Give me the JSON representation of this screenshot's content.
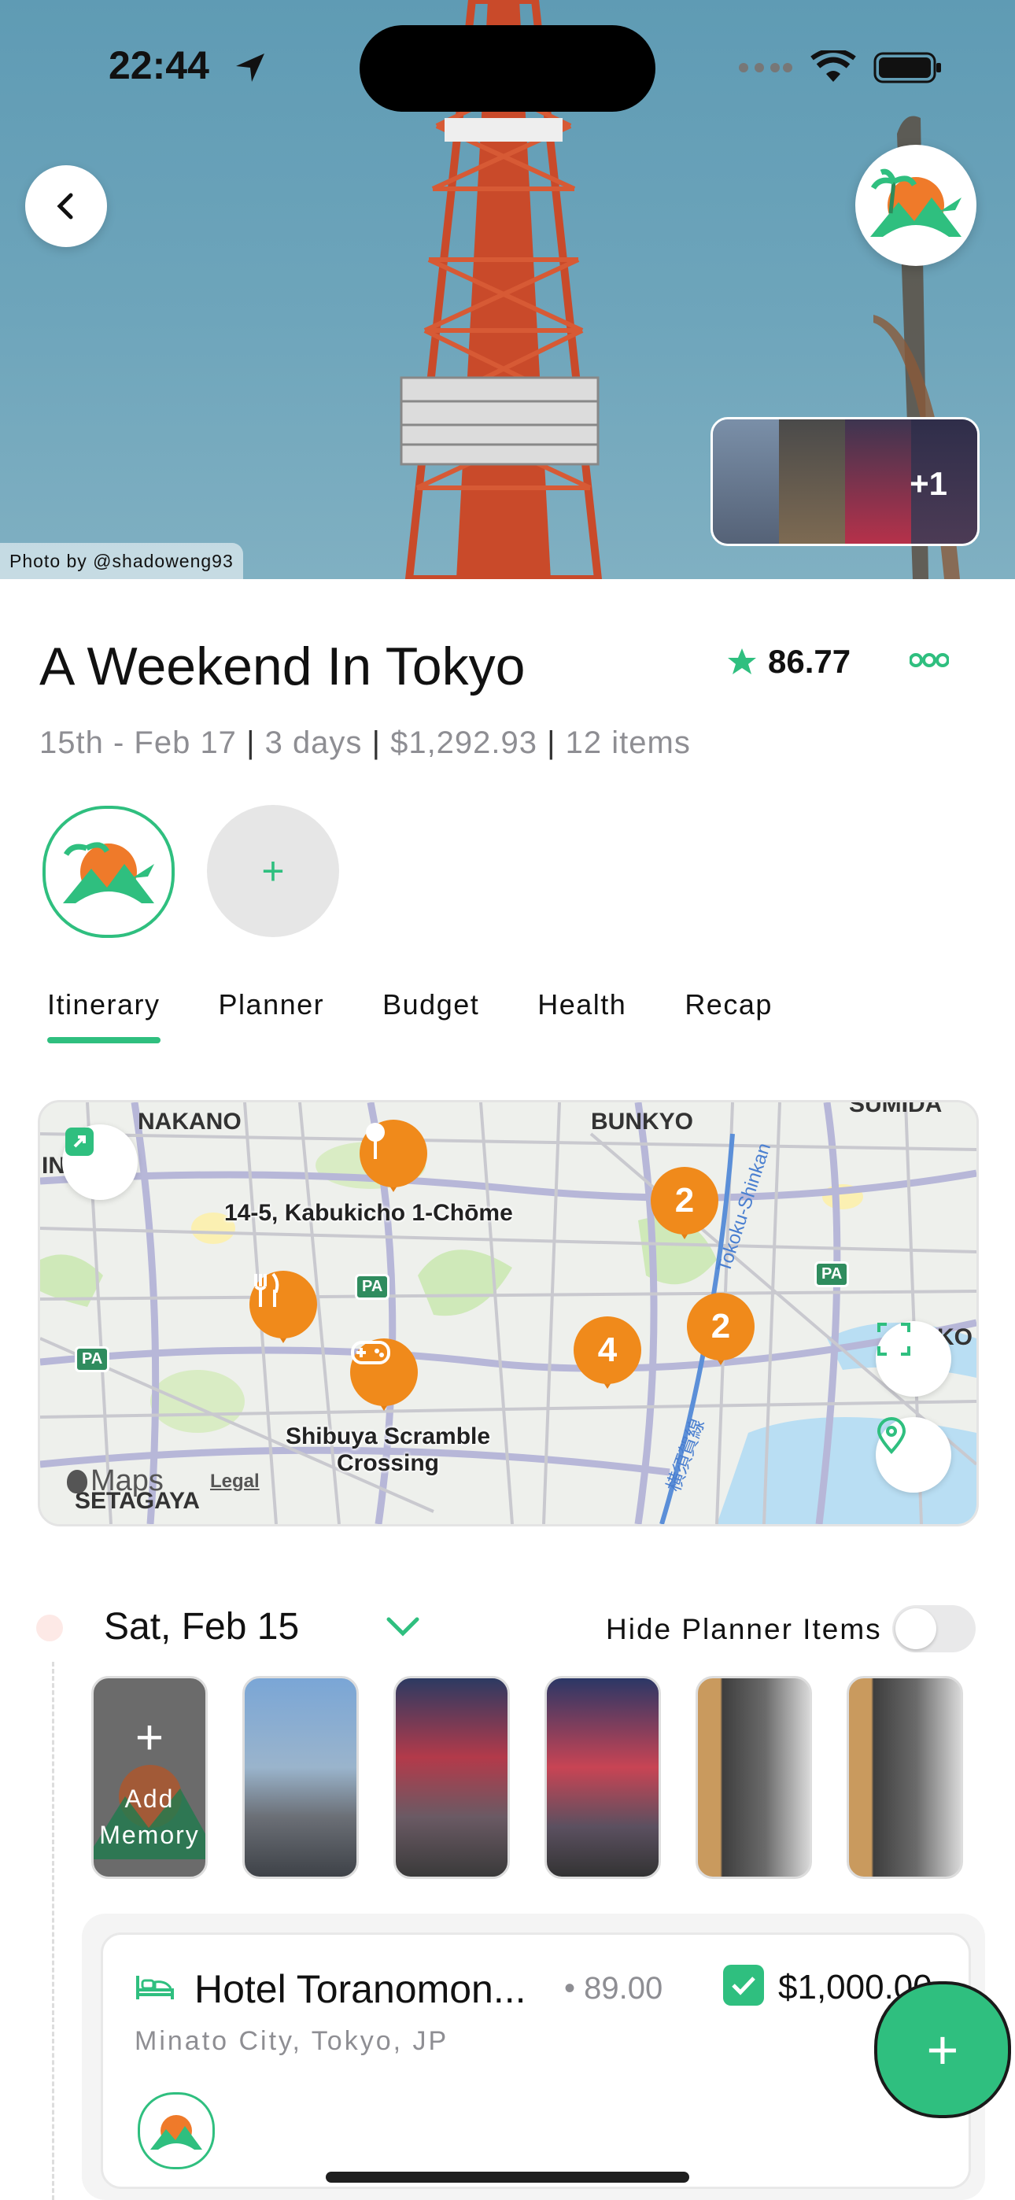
{
  "status": {
    "time": "22:44"
  },
  "hero": {
    "photo_credit": "Photo by @shadoweng93",
    "more_photos": "+1"
  },
  "trip": {
    "title": "A Weekend In Tokyo",
    "score": "86.77",
    "dates": "15th - Feb 17",
    "duration": "3 days",
    "cost": "$1,292.93",
    "items": "12 items",
    "sep": "|"
  },
  "add_member": "+",
  "tabs": [
    "Itinerary",
    "Planner",
    "Budget",
    "Health",
    "Recap"
  ],
  "map": {
    "areas": [
      "NAKANO",
      "BUNKYO",
      "SUMIDA",
      "SETAGAYA",
      "KO",
      "IN"
    ],
    "pins": [
      {
        "label": "14-5, Kabukicho 1-Chōme",
        "glyph": "pin-icon"
      },
      {
        "label": "2"
      },
      {
        "label": "2"
      },
      {
        "label": "4"
      },
      {
        "label": "fork-knife-icon"
      },
      {
        "label": "gamepad-icon"
      }
    ],
    "place_labels": [
      "14-5, Kabukicho 1-Chōme",
      "Shibuya Scramble",
      "Crossing"
    ],
    "road_label": "Tokoku-Shinkan",
    "road_label2": "横須賀線",
    "badge": "PA",
    "attribution": "Maps",
    "legal": "Legal"
  },
  "day": {
    "title": "Sat, Feb 15",
    "hide_label": "Hide Planner Items",
    "hide_on": false
  },
  "memory": {
    "add_plus": "+",
    "add_line1": "Add",
    "add_line2": "Memory"
  },
  "item": {
    "title": "Hotel Toranomon...",
    "rating": "• 89.00",
    "price": "$1,000.00",
    "location": "Minato City, Tokyo, JP",
    "checked": true
  },
  "fab": "+",
  "colors": {
    "accent": "#2fbf7f",
    "pin": "#f08a1b"
  }
}
